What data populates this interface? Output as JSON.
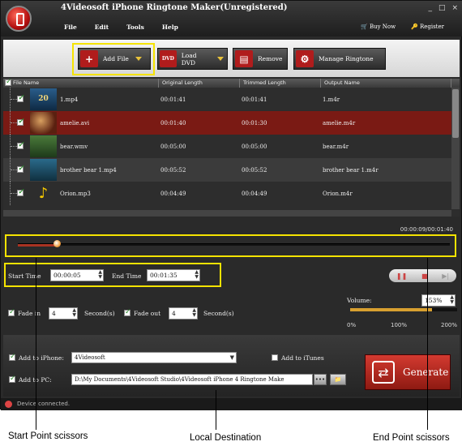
{
  "window": {
    "title": "4Videosoft iPhone Ringtone Maker(Unregistered)",
    "controls": [
      "_",
      "□",
      "×"
    ]
  },
  "menu": [
    "File",
    "Edit",
    "Tools",
    "Help"
  ],
  "account": {
    "buy_now": "Buy Now",
    "register": "Register"
  },
  "toolbar": {
    "add_file": "Add File",
    "load_dvd": "Load DVD",
    "remove": "Remove",
    "manage_ringtone": "Manage Ringtone"
  },
  "table": {
    "headers": [
      "File Name",
      "Original Length",
      "Trimmed Length",
      "Output Name"
    ],
    "rows": [
      {
        "name": "1.mp4",
        "original": "00:01:41",
        "trimmed": "00:01:41",
        "output": "1.m4r",
        "thumb": "20th-century-fox-logo"
      },
      {
        "name": "amelie.avi",
        "original": "00:01:40",
        "trimmed": "00:01:30",
        "output": "amelie.m4r",
        "thumb": "amelie-frame"
      },
      {
        "name": "bear.wmv",
        "original": "00:05:00",
        "trimmed": "00:05:00",
        "output": "bear.m4r",
        "thumb": "bear-frame"
      },
      {
        "name": "brother bear 1.mp4",
        "original": "00:05:52",
        "trimmed": "00:05:52",
        "output": "brother bear 1.m4r",
        "thumb": "brother-bear-frame"
      },
      {
        "name": "Orion.mp3",
        "original": "00:04:49",
        "trimmed": "00:04:49",
        "output": "Orion.m4r",
        "thumb": "music-note-icon"
      }
    ]
  },
  "player": {
    "time_display": "00:00:09/00:01:40",
    "position_fraction": 0.09
  },
  "trim": {
    "start_label": "Start Time",
    "start_value": "00:00:05",
    "end_label": "End Time",
    "end_value": "00:01:35"
  },
  "fade": {
    "fade_in_label": "Fade in",
    "fade_in_value": "4",
    "fade_out_label": "Fade out",
    "fade_out_value": "4",
    "seconds_label": "Second(s)"
  },
  "volume": {
    "label": "Volume:",
    "value": "153%",
    "fraction": 0.765,
    "ticks": [
      "0%",
      "100%",
      "200%"
    ]
  },
  "output": {
    "iphone_label": "Add to iPhone:",
    "iphone_value": "4Videosoft",
    "itunes_label": "Add to iTunes",
    "pc_label": "Add to PC:",
    "pc_path": "D:\\My Documents\\4Videosoft Studio\\4Videosoft iPhone 4 Ringtone Make",
    "browse_label": "•••",
    "generate_label": "Generate"
  },
  "status": {
    "text": "Device connected."
  },
  "callouts": {
    "start_point": "Start Point scissors",
    "local_destination": "Local Destination",
    "end_point": "End Point scissors"
  },
  "colors": {
    "accent_red": "#7a1a14",
    "highlight": "#f5e300",
    "generate": "#d33a30"
  }
}
